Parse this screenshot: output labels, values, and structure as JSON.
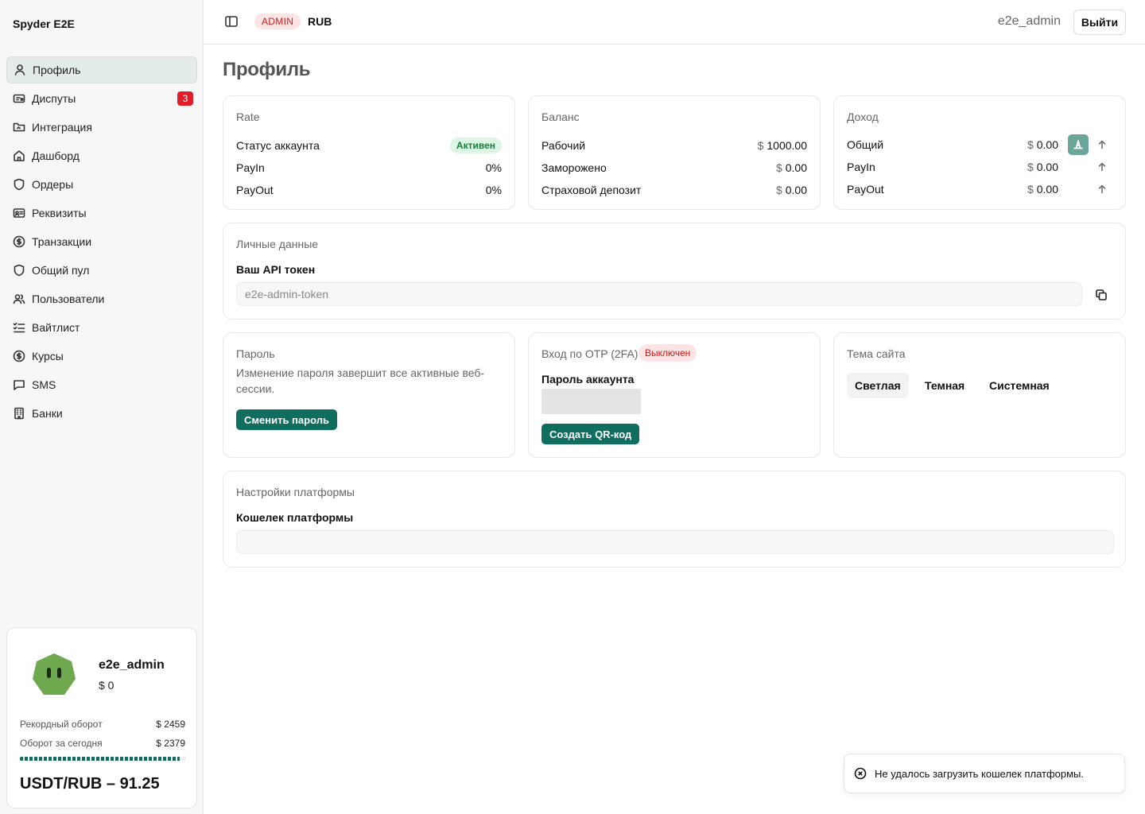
{
  "sidebar": {
    "brand": "Spyder E2E",
    "items": [
      {
        "label": "Профиль",
        "icon": "user-icon"
      },
      {
        "label": "Диспуты",
        "icon": "ticket-icon",
        "badge": "3"
      },
      {
        "label": "Интеграция",
        "icon": "folder-icon"
      },
      {
        "label": "Дашборд",
        "icon": "home-icon"
      },
      {
        "label": "Ордеры",
        "icon": "shield-icon"
      },
      {
        "label": "Реквизиты",
        "icon": "id-card-icon"
      },
      {
        "label": "Транзакции",
        "icon": "dollar-circle-icon"
      },
      {
        "label": "Общий пул",
        "icon": "shield-icon"
      },
      {
        "label": "Пользователи",
        "icon": "users-icon"
      },
      {
        "label": "Вайтлист",
        "icon": "checklist-icon"
      },
      {
        "label": "Курсы",
        "icon": "dollar-circle-icon"
      },
      {
        "label": "SMS",
        "icon": "message-icon"
      },
      {
        "label": "Банки",
        "icon": "building-icon"
      }
    ],
    "user_card": {
      "name": "e2e_admin",
      "balance": "$ 0",
      "record_label": "Рекордный оборот",
      "record_value": "$ 2459",
      "today_label": "Оборот за сегодня",
      "today_value": "$ 2379",
      "today_progress": 0.967,
      "rate": "USDT/RUB – 91.25"
    }
  },
  "header": {
    "role": "ADMIN",
    "currency": "RUB",
    "username": "e2e_admin",
    "logout_label": "Выйти"
  },
  "page": {
    "title": "Профиль",
    "rate_card": {
      "title": "Rate",
      "status_label": "Статус аккаунта",
      "status_value": "Активен",
      "payin_label": "PayIn",
      "payin_value": "0%",
      "payout_label": "PayOut",
      "payout_value": "0%"
    },
    "balance_card": {
      "title": "Баланс",
      "rows": [
        {
          "label": "Рабочий",
          "currency": "$",
          "value": "1000.00"
        },
        {
          "label": "Заморожено",
          "currency": "$",
          "value": "0.00"
        },
        {
          "label": "Страховой депозит",
          "currency": "$",
          "value": "0.00"
        }
      ]
    },
    "income_card": {
      "title": "Доход",
      "rows": [
        {
          "label": "Общий",
          "currency": "$",
          "value": "0.00"
        },
        {
          "label": "PayIn",
          "currency": "$",
          "value": "0.00"
        },
        {
          "label": "PayOut",
          "currency": "$",
          "value": "0.00"
        }
      ]
    },
    "personal_card": {
      "title": "Личные данные",
      "token_label": "Ваш API токен",
      "token_value": "e2e-admin-token"
    },
    "password_card": {
      "title": "Пароль",
      "description": "Изменение пароля завершит все активные веб-сессии.",
      "button": "Сменить пароль"
    },
    "otp_card": {
      "title": "Вход по OTP (2FA)",
      "status": "Выключен",
      "password_label": "Пароль аккаунта",
      "button": "Создать QR-код"
    },
    "theme_card": {
      "title": "Тема сайта",
      "options": [
        "Светлая",
        "Темная",
        "Системная"
      ],
      "selected": "Светлая"
    },
    "platform_card": {
      "title": "Настройки платформы",
      "wallet_label": "Кошелек платформы",
      "wallet_value": ""
    }
  },
  "toast": {
    "message": "Не удалось загрузить кошелек платформы."
  },
  "colors": {
    "accent": "#0f6e5e",
    "danger": "#e11d2a",
    "success_bg": "#dcf5e4",
    "success_text": "#16803c"
  }
}
